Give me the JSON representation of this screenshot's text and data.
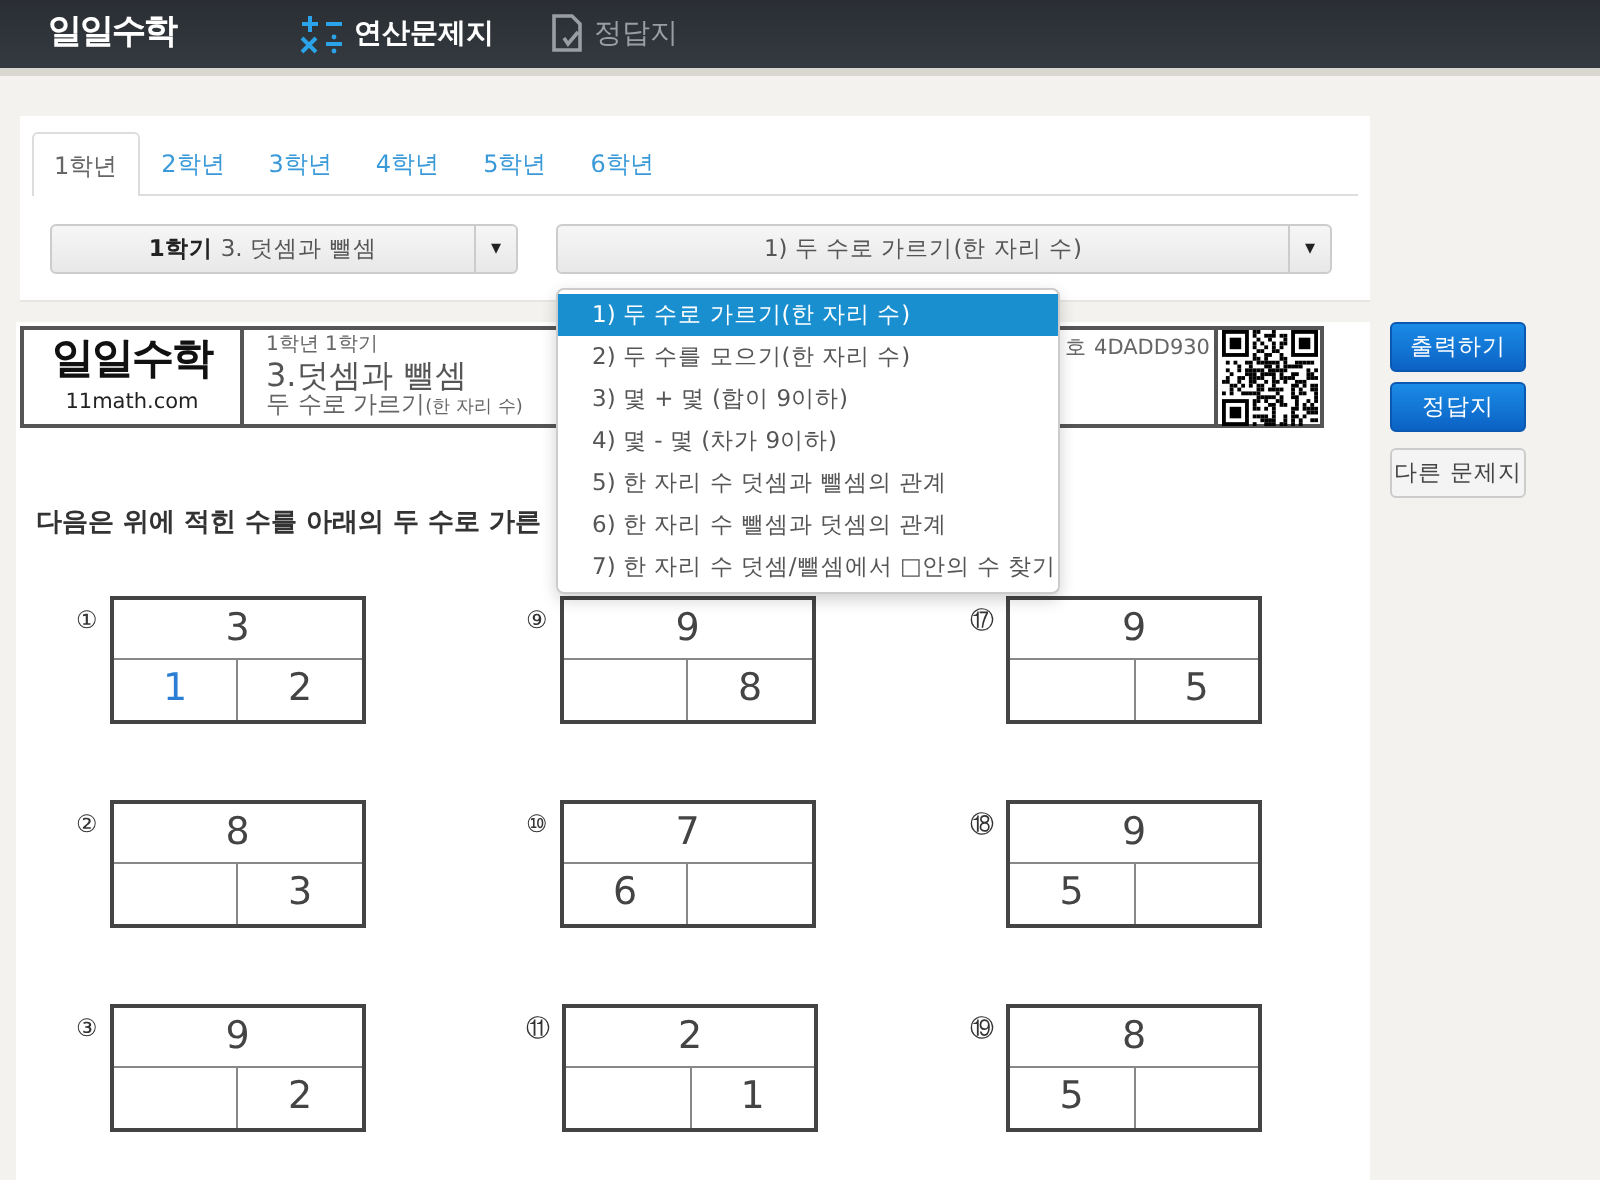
{
  "nav": {
    "logo": "일일수학",
    "links": [
      {
        "label": "연산문제지",
        "selected": true
      },
      {
        "label": "정답지",
        "selected": false
      }
    ]
  },
  "tabs": [
    {
      "label": "1학년",
      "selected": true
    },
    {
      "label": "2학년",
      "selected": false
    },
    {
      "label": "3학년",
      "selected": false
    },
    {
      "label": "4학년",
      "selected": false
    },
    {
      "label": "5학년",
      "selected": false
    },
    {
      "label": "6학년",
      "selected": false
    }
  ],
  "unit_select": {
    "term": "1학기",
    "unit": "3. 덧셈과 뺄셈",
    "caret": "▾"
  },
  "topic_select": {
    "value": "1) 두 수로 가르기(한 자리 수)",
    "caret": "▾",
    "expanded": true,
    "options": [
      {
        "label": "1) 두 수로 가르기(한 자리 수)",
        "selected": true
      },
      {
        "label": "2) 두 수를 모으기(한 자리 수)",
        "selected": false
      },
      {
        "label": "3) 몇 + 몇 (합이 9이하)",
        "selected": false
      },
      {
        "label": "4) 몇 - 몇 (차가 9이하)",
        "selected": false
      },
      {
        "label": "5) 한 자리 수 덧셈과 뺄셈의 관계",
        "selected": false
      },
      {
        "label": "6) 한 자리 수 뺄셈과 덧셈의 관계",
        "selected": false
      },
      {
        "label": "7) 한 자리 수 덧셈/뺄셈에서 □안의 수 찾기",
        "selected": false
      }
    ]
  },
  "sheet": {
    "logo": "일일수학",
    "site": "11math.com",
    "grade": "1학년 1학기",
    "title": "3.덧셈과 뺄셈",
    "subtitle": "두 수로 가르기",
    "subtitle_note": "(한 자리 수)",
    "number": "호 4DADD930",
    "instruction": "다음은 위에 적힌 수를 아래의 두 수로 가른"
  },
  "actions": [
    {
      "label": "출력하기",
      "kind": "primary"
    },
    {
      "label": "정답지",
      "kind": "primary"
    },
    {
      "label": "다른 문제지",
      "kind": "light"
    }
  ],
  "problems": [
    {
      "number": "①",
      "total": "3",
      "parts": [
        {
          "kind": "answer",
          "text": "1"
        },
        {
          "kind": "given",
          "text": "2"
        }
      ]
    },
    {
      "number": "⑨",
      "total": "9",
      "parts": [
        {
          "kind": "blank"
        },
        {
          "kind": "given",
          "text": "8"
        }
      ]
    },
    {
      "number": "⑰",
      "total": "9",
      "parts": [
        {
          "kind": "blank"
        },
        {
          "kind": "given",
          "text": "5"
        }
      ]
    },
    {
      "number": "②",
      "total": "8",
      "parts": [
        {
          "kind": "blank"
        },
        {
          "kind": "given",
          "text": "3"
        }
      ]
    },
    {
      "number": "⑩",
      "total": "7",
      "parts": [
        {
          "kind": "given",
          "text": "6"
        },
        {
          "kind": "blank"
        }
      ]
    },
    {
      "number": "⑱",
      "total": "9",
      "parts": [
        {
          "kind": "given",
          "text": "5"
        },
        {
          "kind": "blank"
        }
      ]
    },
    {
      "number": "③",
      "total": "9",
      "parts": [
        {
          "kind": "blank"
        },
        {
          "kind": "given",
          "text": "2"
        }
      ]
    },
    {
      "number": "⑪",
      "total": "2",
      "parts": [
        {
          "kind": "blank"
        },
        {
          "kind": "given",
          "text": "1"
        }
      ]
    },
    {
      "number": "⑲",
      "total": "8",
      "parts": [
        {
          "kind": "given",
          "text": "5"
        },
        {
          "kind": "blank"
        }
      ]
    }
  ]
}
